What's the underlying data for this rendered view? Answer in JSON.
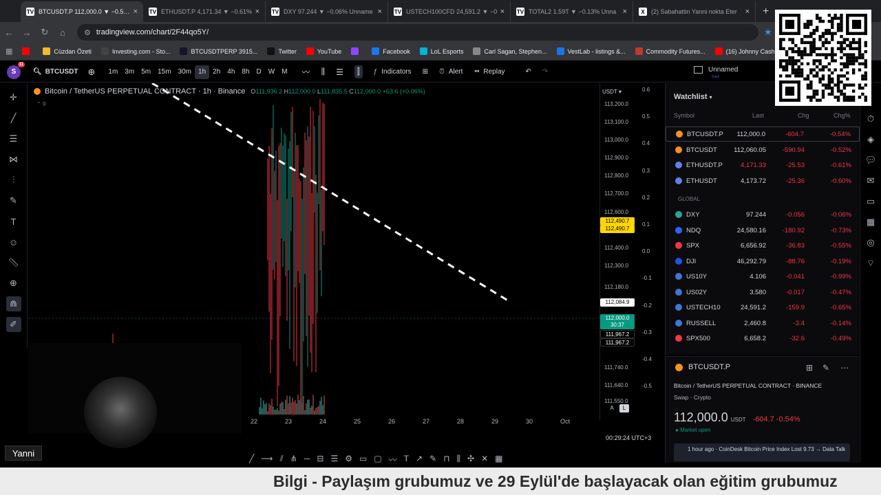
{
  "browser": {
    "tabs": [
      {
        "fav": "TV",
        "title": "BTCUSDT.P 112,000.0 ▼ −0.54%",
        "active": true
      },
      {
        "fav": "TV",
        "title": "ETHUSDT.P 4,171.34 ▼ −0.61%"
      },
      {
        "fav": "TV",
        "title": "DXY 97.244 ▼ −0.06% Unname"
      },
      {
        "fav": "TV",
        "title": "USTECH100CFD 24,591.2 ▼ −0"
      },
      {
        "fav": "TV",
        "title": "TOTAL2 1.59T ▼ −0.13% Unna"
      },
      {
        "fav": "X",
        "title": "(2) Sabahattin Yanni nokta Eter"
      }
    ],
    "url": "tradingview.com/chart/2F44qo5Y/",
    "bookmarks": [
      {
        "label": "",
        "color": "#ff0000"
      },
      {
        "label": "Cüzdan Özeti",
        "color": "#f3ba2f"
      },
      {
        "label": "Investing.com - Sto...",
        "color": "#444"
      },
      {
        "label": "BTCUSDTPERP 3915...",
        "color": "#131722"
      },
      {
        "label": "Twitter",
        "color": "#111"
      },
      {
        "label": "YouTube",
        "color": "#ff0000"
      },
      {
        "label": "",
        "color": "#9146ff"
      },
      {
        "label": "Facebook",
        "color": "#1877f2"
      },
      {
        "label": "LoL Esports",
        "color": "#00b4d8"
      },
      {
        "label": "Carl Sagan, Stephen...",
        "color": "#888"
      },
      {
        "label": "VestLab - listings &...",
        "color": "#1a73e8"
      },
      {
        "label": "Commodity Futures...",
        "color": "#c0392b"
      },
      {
        "label": "(16) Johnny Cash -...",
        "color": "#ff0000"
      }
    ]
  },
  "toolbar": {
    "avatar": "S",
    "avatar_badge": "11",
    "symbol": "BTCUSDT",
    "timeframes": [
      "1m",
      "3m",
      "5m",
      "15m",
      "30m",
      "1h",
      "2h",
      "4h",
      "8h",
      "D",
      "W",
      "M"
    ],
    "active_tf": "1h",
    "indicators": "Indicators",
    "alert": "Alert",
    "replay": "Replay",
    "layout_name": "Unnamed",
    "layout_sub": "Save"
  },
  "chart": {
    "legend_title": "Bitcoin / TetherUS PERPETUAL CONTRACT · 1h · Binance",
    "o": "111,936.2",
    "h": "112,000.0",
    "l": "111,835.5",
    "c": "112,000.0",
    "change": "+63.6 (+0.06%)",
    "legend_sub": "9",
    "currency": "USDT",
    "price_ticks": [
      "113,200.0",
      "113,100.0",
      "113,000.0",
      "112,900.0",
      "112,800.0",
      "112,700.0",
      "112,600.0",
      "112,490.7",
      "112,400.0",
      "112,300.0",
      "112,180.0",
      "112,084.9",
      "112,000.0",
      "111,967.2",
      "111,740.0",
      "111,640.0",
      "111,550.0"
    ],
    "price_labels": [
      {
        "text": "112,490.7",
        "bg": "#ffd600",
        "fg": "#000"
      },
      {
        "text": "112,490.7",
        "bg": "#ffd600",
        "fg": "#000"
      },
      {
        "text": "112,084.9",
        "bg": "#fff",
        "fg": "#000"
      },
      {
        "text": "112,000.0",
        "bg": "#089981",
        "fg": "#fff"
      },
      {
        "text": "30:37",
        "bg": "#089981",
        "fg": "#fff"
      },
      {
        "text": "111,967.2",
        "bg": "#000",
        "fg": "#fff"
      },
      {
        "text": "111,967.2",
        "bg": "#000",
        "fg": "#fff"
      }
    ],
    "pct_ticks": [
      "0.6",
      "0.5",
      "0.4",
      "0.3",
      "0.2",
      "0.1",
      "0.0",
      "-0.1",
      "-0.2",
      "-0.3",
      "-0.4",
      "-0.5"
    ],
    "time_ticks": [
      "22",
      "23",
      "24",
      "25",
      "26",
      "27",
      "28",
      "29",
      "30",
      "Oct"
    ],
    "clock": "00:29:24 UTC+3",
    "btn_a": "A",
    "btn_l": "L"
  },
  "watchlist": {
    "title": "Watchlist",
    "headers": {
      "symbol": "Symbol",
      "last": "Last",
      "chg": "Chg",
      "chgp": "Chg%"
    },
    "section": "GLOBAL",
    "rows": [
      {
        "sym": "BTCUSDT.P",
        "last": "112,000.0",
        "chg": "-604.7",
        "chgp": "-0.54%",
        "ic": "#f7931a",
        "sel": true
      },
      {
        "sym": "BTCUSDT",
        "last": "112,060.05",
        "chg": "-590.94",
        "chgp": "-0.52%",
        "ic": "#f7931a"
      },
      {
        "sym": "ETHUSDT.P",
        "last": "4,171.33",
        "chg": "-25.53",
        "chgp": "-0.61%",
        "ic": "#627eea",
        "lastred": true
      },
      {
        "sym": "ETHUSDT",
        "last": "4,173.72",
        "chg": "-25.36",
        "chgp": "-0.60%",
        "ic": "#627eea"
      },
      {
        "sym": "DXY",
        "last": "97.244",
        "chg": "-0.056",
        "chgp": "-0.06%",
        "ic": "#26a69a"
      },
      {
        "sym": "NDQ",
        "last": "24,580.16",
        "chg": "-180.92",
        "chgp": "-0.73%",
        "ic": "#2962ff"
      },
      {
        "sym": "SPX",
        "last": "6,656.92",
        "chg": "-36.83",
        "chgp": "-0.55%",
        "ic": "#f23645"
      },
      {
        "sym": "DJI",
        "last": "46,292.79",
        "chg": "-88.76",
        "chgp": "-0.19%",
        "ic": "#1e53e5"
      },
      {
        "sym": "US10Y",
        "last": "4.106",
        "chg": "-0.041",
        "chgp": "-0.99%",
        "ic": "#3c78d8"
      },
      {
        "sym": "US02Y",
        "last": "3.580",
        "chg": "-0.017",
        "chgp": "-0.47%",
        "ic": "#3c78d8"
      },
      {
        "sym": "USTECH10",
        "last": "24,591.2",
        "chg": "-159.9",
        "chgp": "-0.65%",
        "ic": "#3c78d8"
      },
      {
        "sym": "RUSSELL",
        "last": "2,460.8",
        "chg": "-3.4",
        "chgp": "-0.14%",
        "ic": "#3c78d8"
      },
      {
        "sym": "SPX500",
        "last": "6,658.2",
        "chg": "-32.6",
        "chgp": "-0.49%",
        "ic": "#f23645"
      }
    ]
  },
  "details": {
    "symbol": "BTCUSDT.P",
    "full_name": "Bitcoin / TetherUS PERPETUAL CONTRACT  ·  BINANCE",
    "type": "Swap · Crypto",
    "price": "112,000.0",
    "currency": "USDT",
    "change": "-604.7  -0.54%",
    "market": "Market open",
    "news": "1 hour ago · CoinDesk Bitcoin Price Index Lost 9.73 → Data Talk"
  },
  "overlay": {
    "name": "Yanni",
    "ticker": "Bilgi - Paylaşım grubumuz ve 29 Eylül'de başlayacak olan eğitim grubumuz"
  },
  "colors": {
    "up": "#089981",
    "down": "#f23645",
    "bg": "#000000",
    "accent": "#2962ff"
  }
}
